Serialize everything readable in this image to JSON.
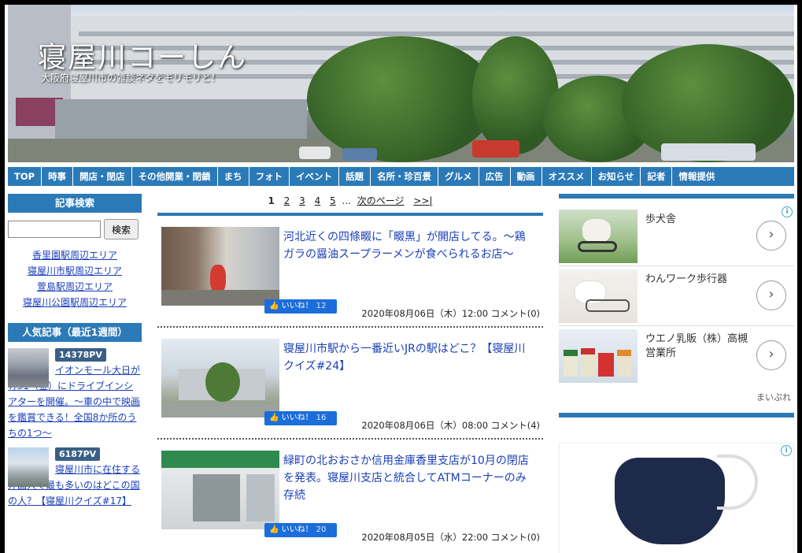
{
  "header": {
    "site_title": "寝屋川コーしん",
    "tagline": "大阪府寝屋川市の雑談ネタをモリモリと！"
  },
  "nav": {
    "items": [
      "TOP",
      "時事",
      "開店・閉店",
      "その他開業・閉鎖",
      "まち",
      "フォト",
      "イベント",
      "話題",
      "名所・珍百景",
      "グルメ",
      "広告",
      "動画",
      "オススメ",
      "お知らせ",
      "記者",
      "情報提供"
    ]
  },
  "search": {
    "heading": "記事検索",
    "input_value": "",
    "button_label": "検索"
  },
  "areas": [
    "香里園駅周辺エリア",
    "寝屋川市駅周辺エリア",
    "萱島駅周辺エリア",
    "寝屋川公園駅周辺エリア"
  ],
  "popular": {
    "heading": "人気記事（最近1週間）",
    "items": [
      {
        "pv": "14378PV",
        "title": "イオンモール大日が7/31（金）にドライブインシアターを開催。～車の中で映画を鑑賞できる！全国8か所のうちの1つ～"
      },
      {
        "pv": "6187PV",
        "title": "寝屋川市に在住する外国人で最も多いのはどこの国の人？【寝屋川クイズ#17】"
      }
    ]
  },
  "pager": {
    "current": "1",
    "pages": [
      "2",
      "3",
      "4",
      "5"
    ],
    "ellipsis": "...",
    "next": "次のページ",
    "last": ">>|"
  },
  "articles": [
    {
      "title": "河北近くの四條畷に「畷黒」が開店してる。～鶏ガラの醤油スープラーメンが食べられるお店～",
      "like_label": "いいね！",
      "likes": "12",
      "meta": "2020年08月06日（木）12:00 コメント(0)"
    },
    {
      "title": "寝屋川市駅から一番近いJRの駅はどこ？【寝屋川クイズ#24】",
      "like_label": "いいね！",
      "likes": "16",
      "meta": "2020年08月06日（木）08:00 コメント(4)"
    },
    {
      "title": "緑町の北おおさか信用金庫香里支店が10月の閉店を発表。寝屋川支店と統合してATMコーナーのみ存続",
      "like_label": "いいね！",
      "likes": "20",
      "meta": "2020年08月05日（水）22:00 コメント(0)"
    }
  ],
  "ads": {
    "items": [
      {
        "text": "歩犬舎"
      },
      {
        "text": "わんワーク歩行器"
      },
      {
        "text": "ウエノ乳販（株）高槻営業所"
      }
    ],
    "brand": "まいぷれ",
    "choice_icon": "i"
  },
  "colors": {
    "accent": "#2b7ab8",
    "link": "#1a3fb8",
    "like": "#1b6ed9"
  }
}
